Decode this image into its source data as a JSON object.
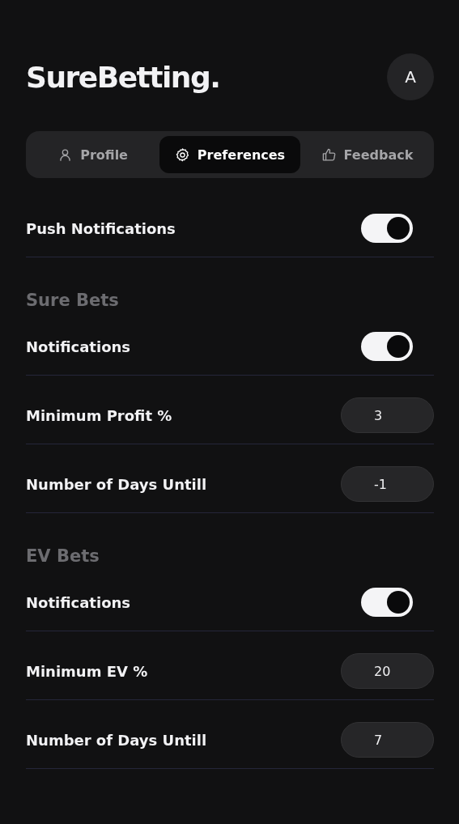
{
  "header": {
    "logo": "SureBetting.",
    "avatar": "A"
  },
  "tabs": [
    {
      "label": "Profile",
      "kind": "profile",
      "selected": false
    },
    {
      "label": "Preferences",
      "kind": "preferences",
      "selected": true
    },
    {
      "label": "Feedback",
      "kind": "feedback",
      "selected": false
    }
  ],
  "sections": [
    {
      "rows": [
        {
          "kind": "toggle",
          "label": "Push Notifications",
          "on": true
        }
      ]
    },
    {
      "title": "Sure Bets",
      "rows": [
        {
          "kind": "toggle",
          "label": "Notifications",
          "on": true
        },
        {
          "kind": "input",
          "label": "Minimum Profit %",
          "value": "3"
        },
        {
          "kind": "input",
          "label": "Number of Days Untill",
          "value": "-1"
        }
      ]
    },
    {
      "title": "EV Bets",
      "rows": [
        {
          "kind": "toggle",
          "label": "Notifications",
          "on": true
        },
        {
          "kind": "input",
          "label": "Minimum EV %",
          "value": "20"
        },
        {
          "kind": "input",
          "label": "Number of Days Untill",
          "value": "7"
        }
      ]
    }
  ]
}
